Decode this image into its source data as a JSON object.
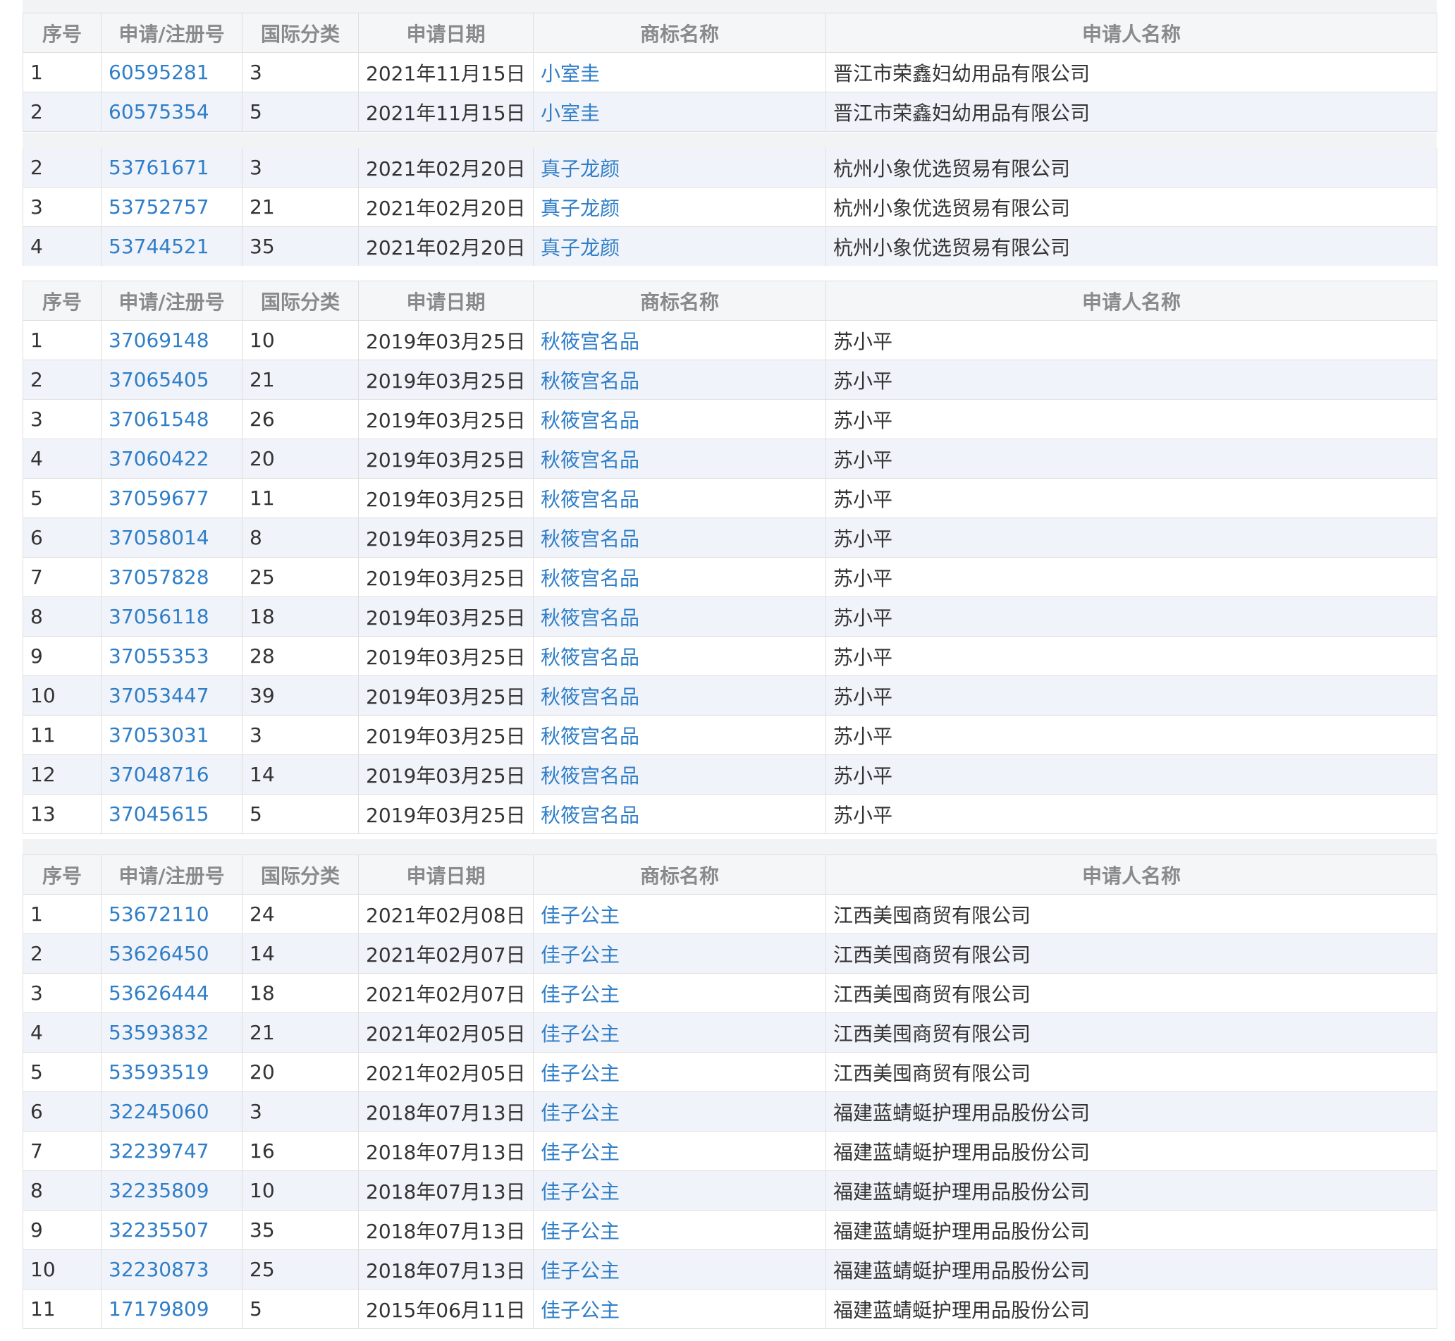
{
  "headers": [
    "序号",
    "申请/注册号",
    "国际分类",
    "申请日期",
    "商标名称",
    "申请人名称"
  ],
  "tables": [
    {
      "show_header": true,
      "rows": [
        {
          "seq": "1",
          "reg_no": "60595281",
          "class": "3",
          "date": "2021年11月15日",
          "mark": "小室圭",
          "applicant": "晋江市荣鑫妇幼用品有限公司"
        },
        {
          "seq": "2",
          "reg_no": "60575354",
          "class": "5",
          "date": "2021年11月15日",
          "mark": "小室圭",
          "applicant": "晋江市荣鑫妇幼用品有限公司"
        }
      ]
    },
    {
      "show_header": false,
      "rows": [
        {
          "seq": "2",
          "reg_no": "53761671",
          "class": "3",
          "date": "2021年02月20日",
          "mark": "真子龙颜",
          "applicant": "杭州小象优选贸易有限公司"
        },
        {
          "seq": "3",
          "reg_no": "53752757",
          "class": "21",
          "date": "2021年02月20日",
          "mark": "真子龙颜",
          "applicant": "杭州小象优选贸易有限公司"
        },
        {
          "seq": "4",
          "reg_no": "53744521",
          "class": "35",
          "date": "2021年02月20日",
          "mark": "真子龙颜",
          "applicant": "杭州小象优选贸易有限公司"
        }
      ]
    },
    {
      "show_header": true,
      "rows": [
        {
          "seq": "1",
          "reg_no": "37069148",
          "class": "10",
          "date": "2019年03月25日",
          "mark": "秋筱宫名品",
          "applicant": "苏小平"
        },
        {
          "seq": "2",
          "reg_no": "37065405",
          "class": "21",
          "date": "2019年03月25日",
          "mark": "秋筱宫名品",
          "applicant": "苏小平"
        },
        {
          "seq": "3",
          "reg_no": "37061548",
          "class": "26",
          "date": "2019年03月25日",
          "mark": "秋筱宫名品",
          "applicant": "苏小平"
        },
        {
          "seq": "4",
          "reg_no": "37060422",
          "class": "20",
          "date": "2019年03月25日",
          "mark": "秋筱宫名品",
          "applicant": "苏小平"
        },
        {
          "seq": "5",
          "reg_no": "37059677",
          "class": "11",
          "date": "2019年03月25日",
          "mark": "秋筱宫名品",
          "applicant": "苏小平"
        },
        {
          "seq": "6",
          "reg_no": "37058014",
          "class": "8",
          "date": "2019年03月25日",
          "mark": "秋筱宫名品",
          "applicant": "苏小平"
        },
        {
          "seq": "7",
          "reg_no": "37057828",
          "class": "25",
          "date": "2019年03月25日",
          "mark": "秋筱宫名品",
          "applicant": "苏小平"
        },
        {
          "seq": "8",
          "reg_no": "37056118",
          "class": "18",
          "date": "2019年03月25日",
          "mark": "秋筱宫名品",
          "applicant": "苏小平"
        },
        {
          "seq": "9",
          "reg_no": "37055353",
          "class": "28",
          "date": "2019年03月25日",
          "mark": "秋筱宫名品",
          "applicant": "苏小平"
        },
        {
          "seq": "10",
          "reg_no": "37053447",
          "class": "39",
          "date": "2019年03月25日",
          "mark": "秋筱宫名品",
          "applicant": "苏小平"
        },
        {
          "seq": "11",
          "reg_no": "37053031",
          "class": "3",
          "date": "2019年03月25日",
          "mark": "秋筱宫名品",
          "applicant": "苏小平"
        },
        {
          "seq": "12",
          "reg_no": "37048716",
          "class": "14",
          "date": "2019年03月25日",
          "mark": "秋筱宫名品",
          "applicant": "苏小平"
        },
        {
          "seq": "13",
          "reg_no": "37045615",
          "class": "5",
          "date": "2019年03月25日",
          "mark": "秋筱宫名品",
          "applicant": "苏小平"
        }
      ]
    },
    {
      "show_header": true,
      "rows": [
        {
          "seq": "1",
          "reg_no": "53672110",
          "class": "24",
          "date": "2021年02月08日",
          "mark": "佳子公主",
          "applicant": "江西美囤商贸有限公司"
        },
        {
          "seq": "2",
          "reg_no": "53626450",
          "class": "14",
          "date": "2021年02月07日",
          "mark": "佳子公主",
          "applicant": "江西美囤商贸有限公司"
        },
        {
          "seq": "3",
          "reg_no": "53626444",
          "class": "18",
          "date": "2021年02月07日",
          "mark": "佳子公主",
          "applicant": "江西美囤商贸有限公司"
        },
        {
          "seq": "4",
          "reg_no": "53593832",
          "class": "21",
          "date": "2021年02月05日",
          "mark": "佳子公主",
          "applicant": "江西美囤商贸有限公司"
        },
        {
          "seq": "5",
          "reg_no": "53593519",
          "class": "20",
          "date": "2021年02月05日",
          "mark": "佳子公主",
          "applicant": "江西美囤商贸有限公司"
        },
        {
          "seq": "6",
          "reg_no": "32245060",
          "class": "3",
          "date": "2018年07月13日",
          "mark": "佳子公主",
          "applicant": "福建蓝蜻蜓护理用品股份公司"
        },
        {
          "seq": "7",
          "reg_no": "32239747",
          "class": "16",
          "date": "2018年07月13日",
          "mark": "佳子公主",
          "applicant": "福建蓝蜻蜓护理用品股份公司"
        },
        {
          "seq": "8",
          "reg_no": "32235809",
          "class": "10",
          "date": "2018年07月13日",
          "mark": "佳子公主",
          "applicant": "福建蓝蜻蜓护理用品股份公司"
        },
        {
          "seq": "9",
          "reg_no": "32235507",
          "class": "35",
          "date": "2018年07月13日",
          "mark": "佳子公主",
          "applicant": "福建蓝蜻蜓护理用品股份公司"
        },
        {
          "seq": "10",
          "reg_no": "32230873",
          "class": "25",
          "date": "2018年07月13日",
          "mark": "佳子公主",
          "applicant": "福建蓝蜻蜓护理用品股份公司"
        },
        {
          "seq": "11",
          "reg_no": "17179809",
          "class": "5",
          "date": "2015年06月11日",
          "mark": "佳子公主",
          "applicant": "福建蓝蜻蜓护理用品股份公司"
        }
      ]
    }
  ]
}
